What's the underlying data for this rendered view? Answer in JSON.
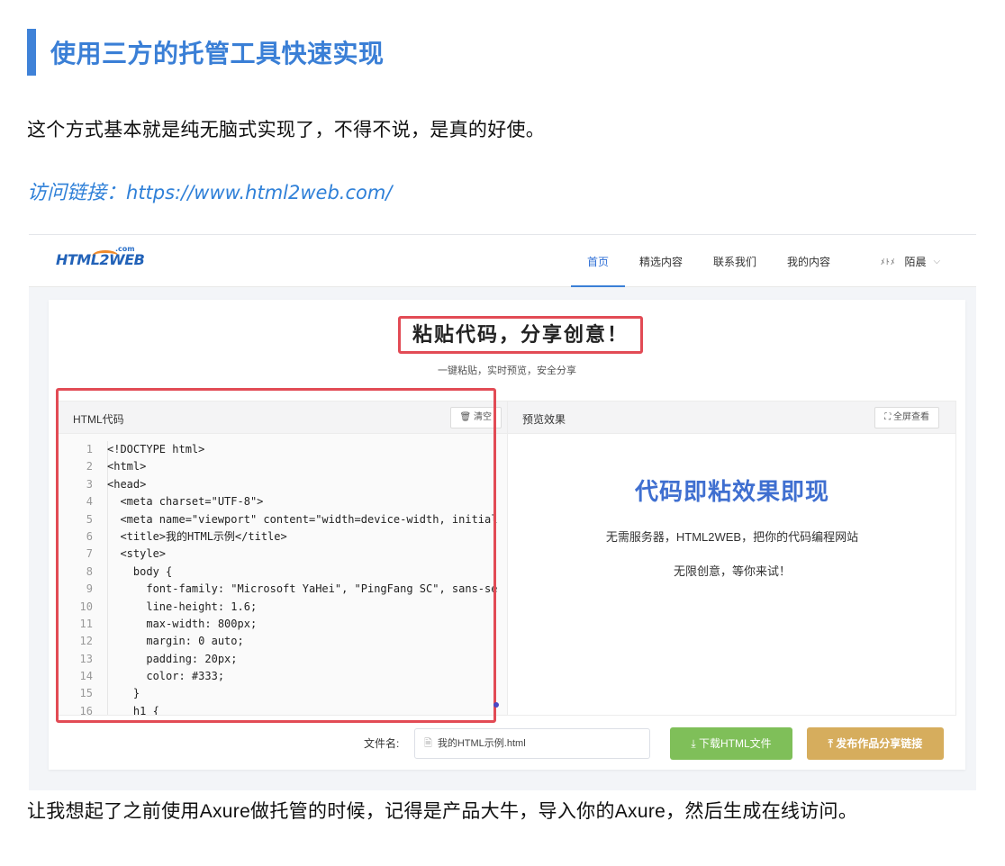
{
  "article": {
    "heading": "使用三方的托管工具快速实现",
    "intro": "这个方式基本就是纯无脑式实现了，不得不说，是真的好使。",
    "link_label": "访问链接：",
    "link_url": "https://www.html2web.com/",
    "outro": "让我想起了之前使用Axure做托管的时候，记得是产品大牛，导入你的Axure，然后生成在线访问。"
  },
  "app": {
    "logo_main": "HTML2WEB",
    "logo_suffix": ".com",
    "nav": [
      "首页",
      "精选内容",
      "联系我们",
      "我的内容"
    ],
    "user_icon": "ﾒﾄﾒ",
    "user_name": "陌晨",
    "hero_title": "粘贴代码，分享创意！",
    "hero_subtitle": "一键粘贴，实时预览，安全分享",
    "editor": {
      "title": "HTML代码",
      "clear_label": "🗑 清空",
      "lines": [
        {
          "n": "1",
          "t": "<!DOCTYPE html>"
        },
        {
          "n": "2",
          "t": "<html>"
        },
        {
          "n": "3",
          "t": "<head>"
        },
        {
          "n": "4",
          "t": "  <meta charset=\"UTF-8\">"
        },
        {
          "n": "5",
          "t": "  <meta name=\"viewport\" content=\"width=device-width, initial"
        },
        {
          "n": "6",
          "t": "  <title>我的HTML示例</title>"
        },
        {
          "n": "7",
          "t": "  <style>"
        },
        {
          "n": "8",
          "t": "    body {"
        },
        {
          "n": "9",
          "t": "      font-family: \"Microsoft YaHei\", \"PingFang SC\", sans-se"
        },
        {
          "n": "10",
          "t": "      line-height: 1.6;"
        },
        {
          "n": "11",
          "t": "      max-width: 800px;"
        },
        {
          "n": "12",
          "t": "      margin: 0 auto;"
        },
        {
          "n": "13",
          "t": "      padding: 20px;"
        },
        {
          "n": "14",
          "t": "      color: #333;"
        },
        {
          "n": "15",
          "t": "    }"
        },
        {
          "n": "16",
          "t": "    h1 {"
        }
      ]
    },
    "preview": {
      "title": "预览效果",
      "fullscreen_label": "⛶ 全屏查看",
      "headline": "代码即粘效果即现",
      "line1": "无需服务器，HTML2WEB，把你的代码编程网站",
      "line2": "无限创意，等你来试！"
    },
    "footer": {
      "filename_label": "文件名:",
      "filename_value": "我的HTML示例.html",
      "download_label": "⤓ 下载HTML文件",
      "share_label": "⤒ 发布作品分享链接"
    }
  },
  "colors": {
    "accent": "#3a7fd6",
    "highlight_box": "#e24b55",
    "download": "#7fbf59",
    "share": "#d6ad5d"
  }
}
